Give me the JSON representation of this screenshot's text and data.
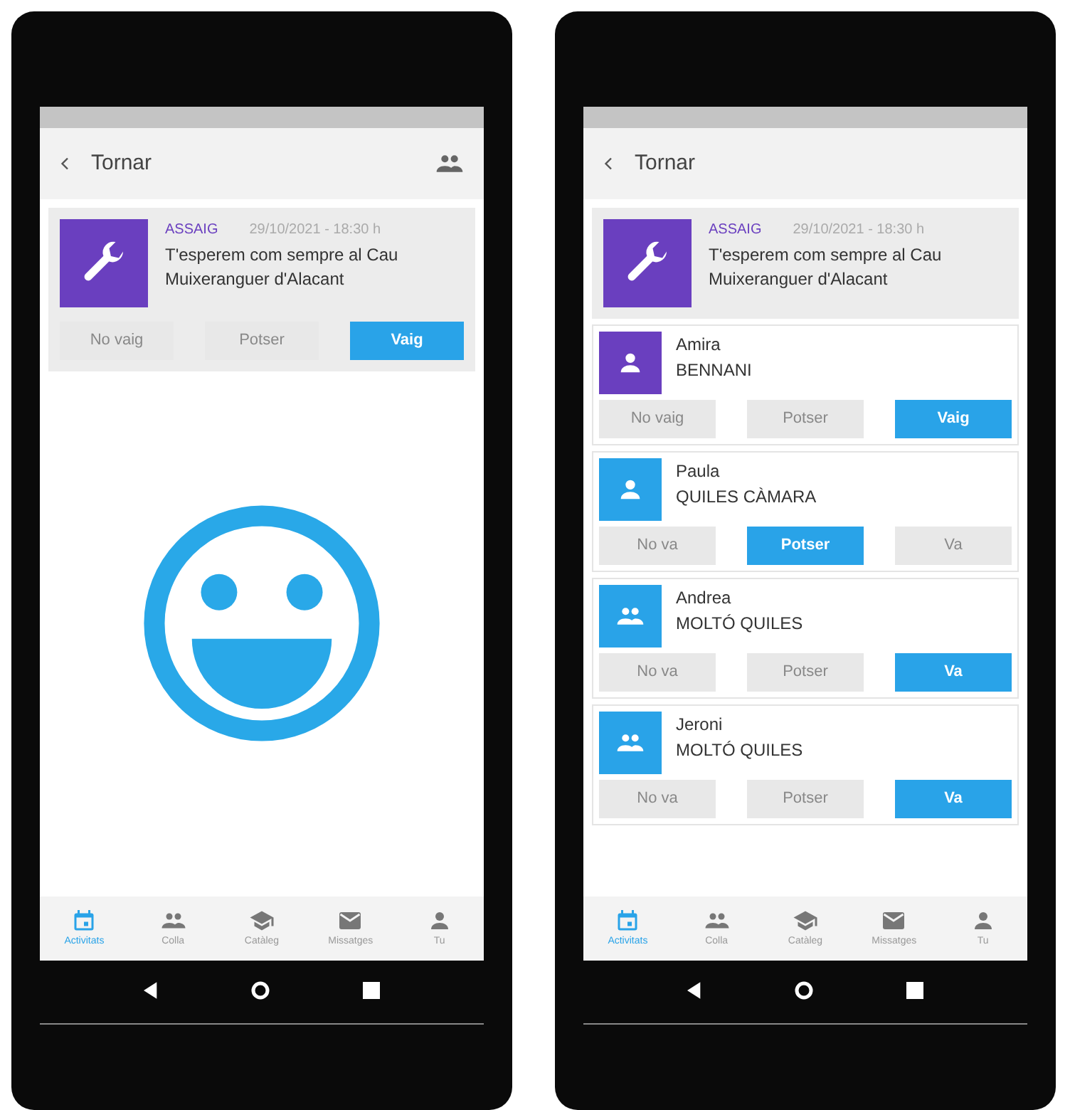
{
  "screens": [
    {
      "header": {
        "title": "Tornar",
        "group_button": true
      },
      "event": {
        "category": "ASSAIG",
        "datetime": "29/10/2021 - 18:30 h",
        "text": "T'esperem com sempre al Cau Muixeranguer d'Alacant",
        "responses": [
          {
            "label": "No vaig",
            "selected": false
          },
          {
            "label": "Potser",
            "selected": false
          },
          {
            "label": "Vaig",
            "selected": true
          }
        ]
      },
      "body": {
        "kind": "smiley"
      },
      "nav": [
        {
          "label": "Activitats",
          "selected": true
        },
        {
          "label": "Colla",
          "selected": false
        },
        {
          "label": "Catàleg",
          "selected": false
        },
        {
          "label": "Missatges",
          "selected": false
        },
        {
          "label": "Tu",
          "selected": false
        }
      ]
    },
    {
      "header": {
        "title": "Tornar",
        "group_button": false
      },
      "event": {
        "category": "ASSAIG",
        "datetime": "29/10/2021 - 18:30 h",
        "text": "T'esperem com sempre al Cau Muixeranguer d'Alacant"
      },
      "body": {
        "kind": "members",
        "members": [
          {
            "first_name": "Amira",
            "surname": "BENNANI",
            "kind": "person",
            "color": "#6a3fbf",
            "responses": [
              {
                "label": "No vaig",
                "selected": false
              },
              {
                "label": "Potser",
                "selected": false
              },
              {
                "label": "Vaig",
                "selected": true
              }
            ]
          },
          {
            "first_name": "Paula",
            "surname": "QUILES CÀMARA",
            "kind": "person",
            "color": "#29a3e8",
            "responses": [
              {
                "label": "No va",
                "selected": false
              },
              {
                "label": "Potser",
                "selected": true
              },
              {
                "label": "Va",
                "selected": false
              }
            ]
          },
          {
            "first_name": "Andrea",
            "surname": "MOLTÓ QUILES",
            "kind": "group",
            "color": "#29a3e8",
            "responses": [
              {
                "label": "No va",
                "selected": false
              },
              {
                "label": "Potser",
                "selected": false
              },
              {
                "label": "Va",
                "selected": true
              }
            ]
          },
          {
            "first_name": "Jeroni",
            "surname": "MOLTÓ QUILES",
            "kind": "group",
            "color": "#29a3e8",
            "responses": [
              {
                "label": "No va",
                "selected": false
              },
              {
                "label": "Potser",
                "selected": false
              },
              {
                "label": "Va",
                "selected": true
              }
            ]
          }
        ]
      },
      "nav": [
        {
          "label": "Activitats",
          "selected": true
        },
        {
          "label": "Colla",
          "selected": false
        },
        {
          "label": "Catàleg",
          "selected": false
        },
        {
          "label": "Missatges",
          "selected": false
        },
        {
          "label": "Tu",
          "selected": false
        }
      ]
    }
  ]
}
